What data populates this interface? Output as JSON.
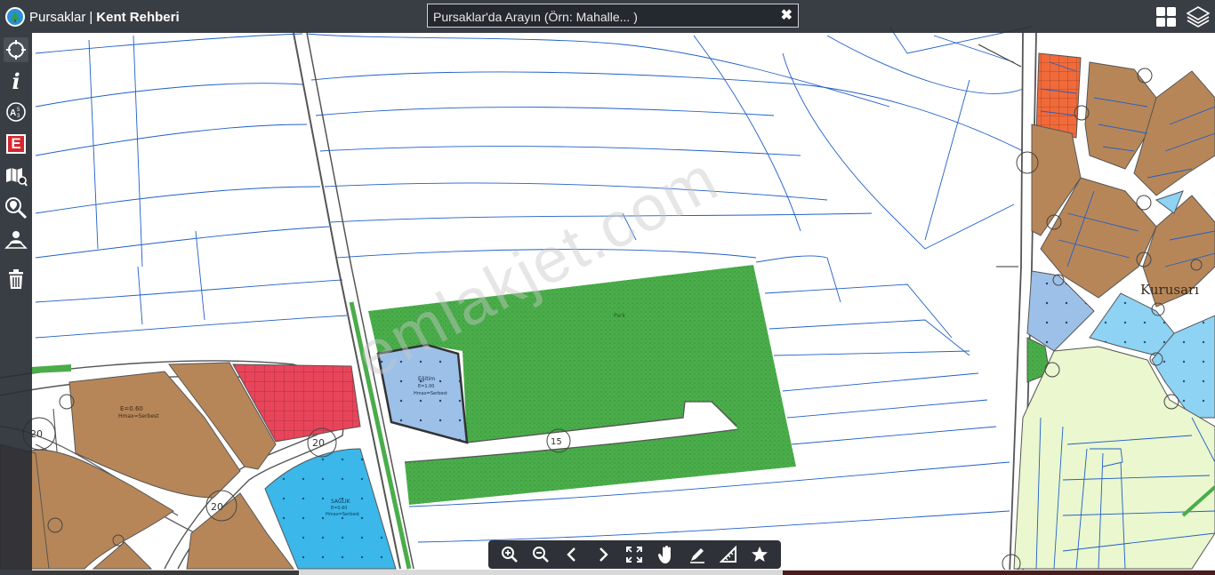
{
  "header": {
    "city_name": "Pursaklar",
    "separator": "|",
    "app_name": "Kent Rehberi"
  },
  "search": {
    "placeholder": "Pursaklar'da Arayın (Örn: Mahalle... )",
    "clear_symbol": "✖"
  },
  "sidebar": {
    "items": [
      {
        "icon": "crosshair-icon"
      },
      {
        "icon": "info-icon",
        "glyph": "i"
      },
      {
        "icon": "abc-label-icon",
        "glyph": "A"
      },
      {
        "icon": "e-government-icon",
        "glyph": "E"
      },
      {
        "icon": "map-search-icon"
      },
      {
        "icon": "location-search-icon"
      },
      {
        "icon": "user-location-icon"
      },
      {
        "icon": "trash-icon"
      }
    ]
  },
  "toolbar": {
    "items": [
      "zoom-in-icon",
      "zoom-out-icon",
      "back-icon",
      "forward-icon",
      "fullscreen-icon",
      "pan-hand-icon",
      "draw-icon",
      "measure-icon",
      "favorite-icon"
    ]
  },
  "topright": {
    "items": [
      "grid-layout-icon",
      "layers-icon"
    ]
  },
  "map": {
    "watermark": "emlakjet.com",
    "district_label": "Kurusarı",
    "road_numbers": [
      "20",
      "20",
      "20",
      "15"
    ],
    "parcel_labels": {
      "e1": "E=0.60",
      "e1b": "Hmax=Serbest",
      "saglik": "SAĞLIK",
      "saglik_e": "E=0.60",
      "saglik_h": "Hmax=Serbest",
      "park": "Park",
      "egitim": "Eğitim",
      "egitim_e": "E=1.00",
      "egitim_h": "Hmax=Serbest"
    },
    "colors": {
      "green_area": "#4aad4a",
      "residential": "#b78658",
      "commercial_red": "#e8455a",
      "commercial_orange": "#f06a3a",
      "health_blue": "#3bb7ea",
      "education_lightblue": "#9cc0e8",
      "light_green": "#eaf7cf",
      "parcel_line": "#1f5fc6"
    }
  }
}
